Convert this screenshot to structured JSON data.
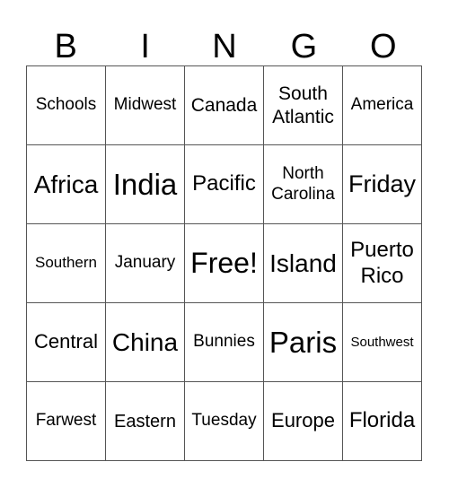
{
  "header": [
    "B",
    "I",
    "N",
    "G",
    "O"
  ],
  "rows": [
    [
      {
        "t": "Schools",
        "s": 19
      },
      {
        "t": "Midwest",
        "s": 19
      },
      {
        "t": "Canada",
        "s": 21
      },
      {
        "t": "South Atlantic",
        "s": 21
      },
      {
        "t": "America",
        "s": 19
      }
    ],
    [
      {
        "t": "Africa",
        "s": 28
      },
      {
        "t": "India",
        "s": 33
      },
      {
        "t": "Pacific",
        "s": 24
      },
      {
        "t": "North Carolina",
        "s": 19
      },
      {
        "t": "Friday",
        "s": 27
      }
    ],
    [
      {
        "t": "Southern",
        "s": 17
      },
      {
        "t": "January",
        "s": 19
      },
      {
        "t": "Free!",
        "s": 32
      },
      {
        "t": "Island",
        "s": 28
      },
      {
        "t": "Puerto Rico",
        "s": 24
      }
    ],
    [
      {
        "t": "Central",
        "s": 22
      },
      {
        "t": "China",
        "s": 28
      },
      {
        "t": "Bunnies",
        "s": 19
      },
      {
        "t": "Paris",
        "s": 33
      },
      {
        "t": "Southwest",
        "s": 15
      }
    ],
    [
      {
        "t": "Farwest",
        "s": 19
      },
      {
        "t": "Eastern",
        "s": 20
      },
      {
        "t": "Tuesday",
        "s": 19
      },
      {
        "t": "Europe",
        "s": 22
      },
      {
        "t": "Florida",
        "s": 24
      }
    ]
  ]
}
